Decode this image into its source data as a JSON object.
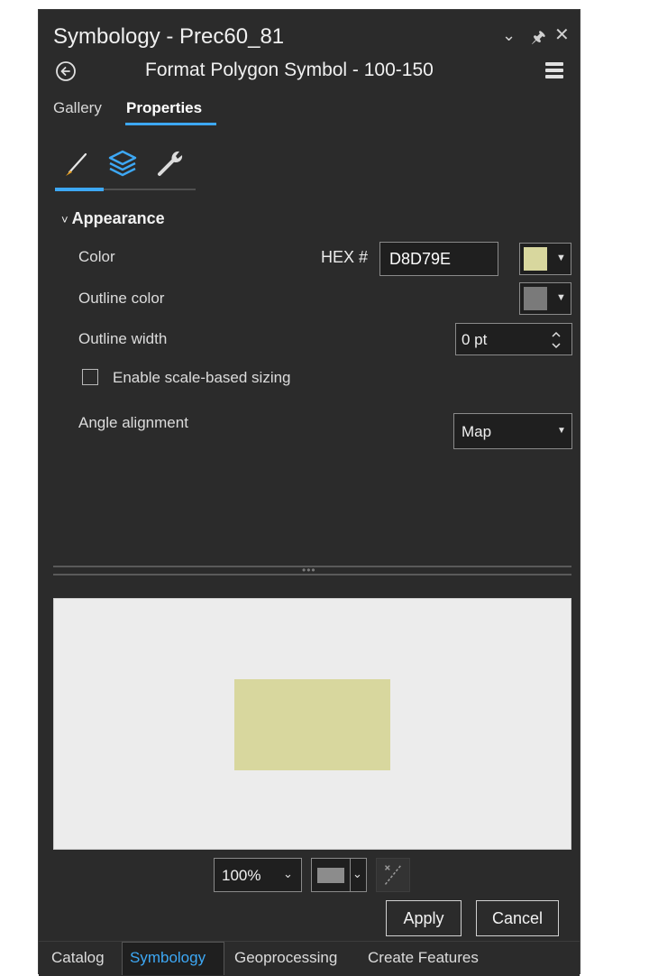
{
  "header": {
    "title": "Symbology - Prec60_81",
    "subtitle": "Format Polygon Symbol - 100-150"
  },
  "tabs": [
    {
      "label": "Gallery",
      "active": false
    },
    {
      "label": "Properties",
      "active": true
    }
  ],
  "tool_icons": [
    "brush-icon",
    "layers-icon",
    "wrench-icon"
  ],
  "appearance": {
    "section_label": "Appearance",
    "color_label": "Color",
    "hex_label": "HEX #",
    "hex_value": "D8D79E",
    "fill_color": "#D8D79E",
    "outline_color_label": "Outline color",
    "outline_color": "#7a7a7a",
    "outline_width_label": "Outline width",
    "outline_width_value": "0 pt",
    "scale_sizing_label": "Enable scale-based sizing",
    "scale_sizing_checked": false,
    "angle_alignment_label": "Angle alignment",
    "angle_alignment_value": "Map"
  },
  "preview": {
    "zoom_value": "100%",
    "background_color": "#8c8c8c"
  },
  "buttons": {
    "apply": "Apply",
    "cancel": "Cancel"
  },
  "bottom_tabs": [
    {
      "label": "Catalog",
      "active": false
    },
    {
      "label": "Symbology",
      "active": true
    },
    {
      "label": "Geoprocessing",
      "active": false
    },
    {
      "label": "Create Features",
      "active": false
    }
  ],
  "colors": {
    "accent": "#3da8f5",
    "panel_bg": "#2b2b2b",
    "preview_bg": "#ececec"
  }
}
